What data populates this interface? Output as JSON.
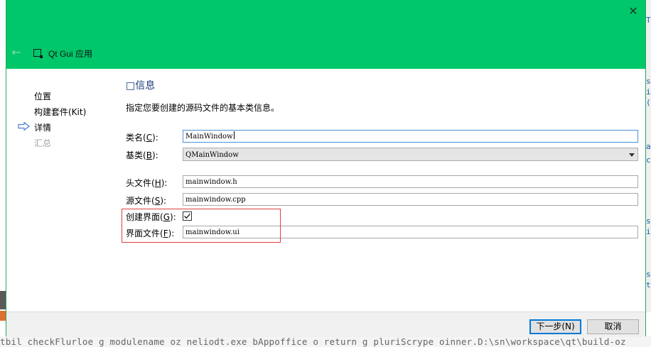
{
  "background": {
    "right_fragments": [
      "T",
      "s",
      "i",
      "(",
      "a",
      "c",
      "s",
      "i",
      "s",
      "t"
    ],
    "bottom_text": "tbil checkFlurloe g modulename oz neliodt.exe bAppoffice o return g pluriScrype oinner.D:\\sn\\workspace\\qt\\build-oz"
  },
  "header": {
    "title": "Qt Gui 应用",
    "back_glyph": "←",
    "close_glyph": "✕",
    "color": "#00c86a"
  },
  "steps": [
    {
      "label": "位置",
      "state": "done"
    },
    {
      "label": "构建套件(Kit)",
      "state": "done"
    },
    {
      "label": "详情",
      "state": "current"
    },
    {
      "label": "汇总",
      "state": "pending"
    }
  ],
  "content": {
    "title": "□信息",
    "subtitle": "指定您要创建的源码文件的基本类信息。",
    "class_name": {
      "label": "类名",
      "mnemonic": "C",
      "value": "MainWindow"
    },
    "base_class": {
      "label": "基类",
      "mnemonic": "B",
      "value": "QMainWindow"
    },
    "header_file": {
      "label": "头文件",
      "mnemonic": "H",
      "value": "mainwindow.h"
    },
    "source_file": {
      "label": "源文件",
      "mnemonic": "S",
      "value": "mainwindow.cpp"
    },
    "generate_form": {
      "label": "创建界面",
      "mnemonic": "G",
      "checked": true
    },
    "form_file": {
      "label": "界面文件",
      "mnemonic": "F",
      "value": "mainwindow.ui"
    }
  },
  "footer": {
    "next_label": "下一步(N)",
    "cancel_label": "取消"
  },
  "colors": {
    "accent": "#0078d7",
    "highlight": "#e04040",
    "arrow": "#4a7fd4"
  }
}
